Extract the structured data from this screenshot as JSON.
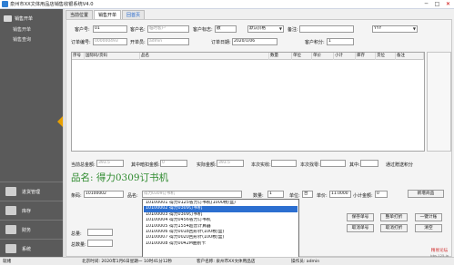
{
  "window": {
    "title": "泉州市XX文体用品店销售收银系统V4.0",
    "buttons": {
      "minimize": "─",
      "maximize": "□",
      "close": "✕"
    }
  },
  "sidebar": {
    "top_group": "销售开单",
    "items": [
      "销售开单",
      "销售查询"
    ],
    "bottom": [
      {
        "label": "进货管理",
        "icon": "cart-icon"
      },
      {
        "label": "库存",
        "icon": "box-icon"
      },
      {
        "label": "财务",
        "icon": "money-icon"
      },
      {
        "label": "系统",
        "icon": "gear-icon"
      }
    ]
  },
  "tabs": [
    "当前位置",
    "销售开单",
    "回首页"
  ],
  "form": {
    "customer_no_label": "客户号:",
    "customer_no": "01",
    "customer_name_label": "客户名:",
    "customer_name": "临时客户",
    "customer_flag_label": "客户标志:",
    "customer_flag": "散",
    "default_price": "默认价格",
    "note_label": "备注:",
    "note": "",
    "right_select": "YYY",
    "order_no_label": "订单编号:",
    "order_no": "000000493",
    "salesman_label": "开单员:",
    "salesman": "admin",
    "order_date_label": "订单日期:",
    "order_date": "2020/1/06",
    "customer_points_label": "客户积分:",
    "customer_points": "1"
  },
  "grid": {
    "headers": [
      "序号",
      "国际码/货码",
      "品名",
      "数量",
      "单位",
      "单价",
      "小计",
      "库存",
      "货位",
      "备注"
    ]
  },
  "summary": {
    "total_amount_label": "当前总金额:",
    "total_amount": "393.5",
    "discount_label": "其中暗扣金额:",
    "discount": "0",
    "actual_label": "实际金额:",
    "actual": "393.5",
    "received_label": "本次实收:",
    "received": "",
    "change_label": "本次找零:",
    "change": "",
    "of_which_label": "其中:",
    "of_which": "",
    "points_label": "通过赠送积分"
  },
  "product_banner": "品名: 得力0309订书机",
  "entry": {
    "barcode_label": "条码:",
    "barcode": "10100002",
    "name_label": "品名:",
    "name": "得力0309订书机",
    "qty_label": "数量:",
    "qty": "1",
    "unit_label": "单位:",
    "unit": "台",
    "price_label": "单价:",
    "price": "11.0000",
    "subtotal_label": "小计金额:",
    "subtotal": "0",
    "add_button": "新增商品"
  },
  "buttons": {
    "save_order": "保存单号",
    "void_order": "整单打折",
    "one_key": "一键计账",
    "cancel_line": "取消单号",
    "cancel_all": "取消打折",
    "clear": "清空"
  },
  "dropdown_items": [
    "10100001 得力0125省力订书机(1000枚/盒)",
    "10100002 得力0309订书机",
    "10100003 得力0309订书机",
    "10100004 得力0456省力订书机",
    "10100005 得力1554超普计算器",
    "10100006 得力0018回形针(100枚/盒)",
    "10100007 得力0020回形针(100枚/盒)",
    "10100008 得力0042M曲别卡"
  ],
  "dropdown_selected": 1,
  "totals": {
    "total_label": "总量:",
    "total": "",
    "total_amount_label": "总数量:",
    "total_amount": ""
  },
  "status": {
    "ready": "就绪",
    "time": "北京时间: 2020年1月6日星期一 10时41分12秒",
    "store": "客户名称: 泉州市XX文体用品店",
    "operator": "操作员: admin"
  },
  "watermark": {
    "line1": "精易论坛",
    "line2": "bbs.125.la"
  }
}
